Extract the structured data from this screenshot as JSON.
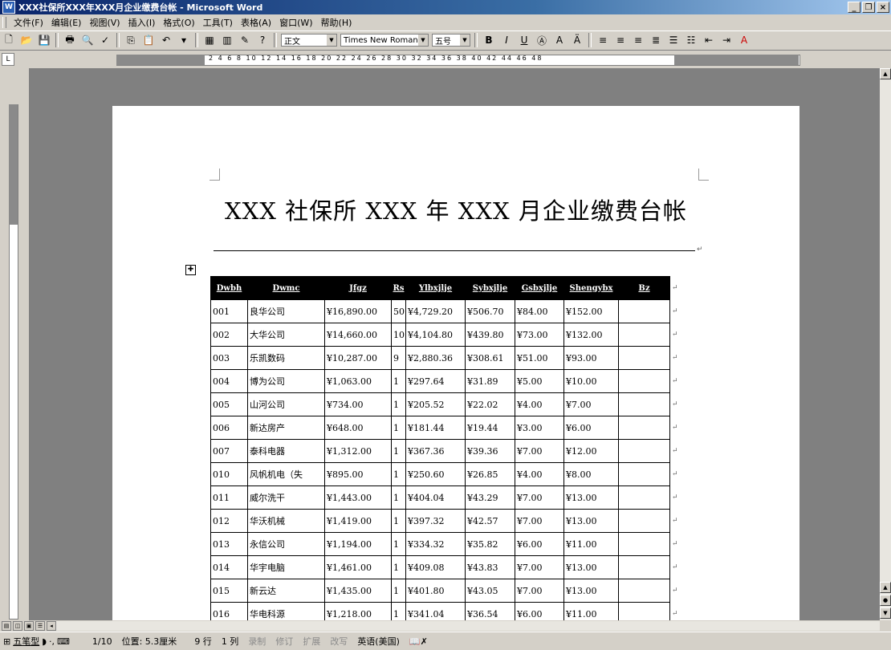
{
  "window": {
    "title": "XXX社保所XXX年XXX月企业缴费台帐 - Microsoft Word"
  },
  "menu": [
    "文件(F)",
    "编辑(E)",
    "视图(V)",
    "插入(I)",
    "格式(O)",
    "工具(T)",
    "表格(A)",
    "窗口(W)",
    "帮助(H)"
  ],
  "toolbar": {
    "style": "正文",
    "font": "Times New Roman",
    "size": "五号"
  },
  "ruler": {
    "numbers": "2 4 6 8 10 12 14 16 18 20 22 24 26 28 30 32 34 36 38 40 42 44 46 48"
  },
  "document": {
    "title": "XXX 社保所 XXX 年 XXX 月企业缴费台帐",
    "table": {
      "headers": [
        "Dwbh",
        "Dwmc",
        "Jfgz",
        "Rs",
        "Ylbxjlje",
        "Sybxjlje",
        "Gsbxjlje",
        "Shengybx",
        "Bz"
      ],
      "rows": [
        [
          "001",
          "良华公司",
          "¥16,890.00",
          "50",
          "¥4,729.20",
          "¥506.70",
          "¥84.00",
          "¥152.00",
          ""
        ],
        [
          "002",
          "大华公司",
          "¥14,660.00",
          "10",
          "¥4,104.80",
          "¥439.80",
          "¥73.00",
          "¥132.00",
          ""
        ],
        [
          "003",
          "乐凯数码",
          "¥10,287.00",
          "9",
          "¥2,880.36",
          "¥308.61",
          "¥51.00",
          "¥93.00",
          ""
        ],
        [
          "004",
          "博为公司",
          "¥1,063.00",
          "1",
          "¥297.64",
          "¥31.89",
          "¥5.00",
          "¥10.00",
          ""
        ],
        [
          "005",
          "山河公司",
          "¥734.00",
          "1",
          "¥205.52",
          "¥22.02",
          "¥4.00",
          "¥7.00",
          ""
        ],
        [
          "006",
          "新达房产",
          "¥648.00",
          "1",
          "¥181.44",
          "¥19.44",
          "¥3.00",
          "¥6.00",
          ""
        ],
        [
          "007",
          "泰科电器",
          "¥1,312.00",
          "1",
          "¥367.36",
          "¥39.36",
          "¥7.00",
          "¥12.00",
          ""
        ],
        [
          "010",
          "风帆机电（失",
          "¥895.00",
          "1",
          "¥250.60",
          "¥26.85",
          "¥4.00",
          "¥8.00",
          ""
        ],
        [
          "011",
          "威尔洗干",
          "¥1,443.00",
          "1",
          "¥404.04",
          "¥43.29",
          "¥7.00",
          "¥13.00",
          ""
        ],
        [
          "012",
          "华沃机械",
          "¥1,419.00",
          "1",
          "¥397.32",
          "¥42.57",
          "¥7.00",
          "¥13.00",
          ""
        ],
        [
          "013",
          "永信公司",
          "¥1,194.00",
          "1",
          "¥334.32",
          "¥35.82",
          "¥6.00",
          "¥11.00",
          ""
        ],
        [
          "014",
          "华宇电脑",
          "¥1,461.00",
          "1",
          "¥409.08",
          "¥43.83",
          "¥7.00",
          "¥13.00",
          ""
        ],
        [
          "015",
          "新云达",
          "¥1,435.00",
          "1",
          "¥401.80",
          "¥43.05",
          "¥7.00",
          "¥13.00",
          ""
        ],
        [
          "016",
          "华电科源",
          "¥1,218.00",
          "1",
          "¥341.04",
          "¥36.54",
          "¥6.00",
          "¥11.00",
          ""
        ]
      ]
    }
  },
  "status": {
    "taskbar_label": "五笔型",
    "page": "1/10",
    "position": "位置: 5.3厘米",
    "line": "9 行",
    "col": "1 列",
    "rec": "录制",
    "trk": "修订",
    "ext": "扩展",
    "ovr": "改写",
    "language": "英语(美国)"
  }
}
